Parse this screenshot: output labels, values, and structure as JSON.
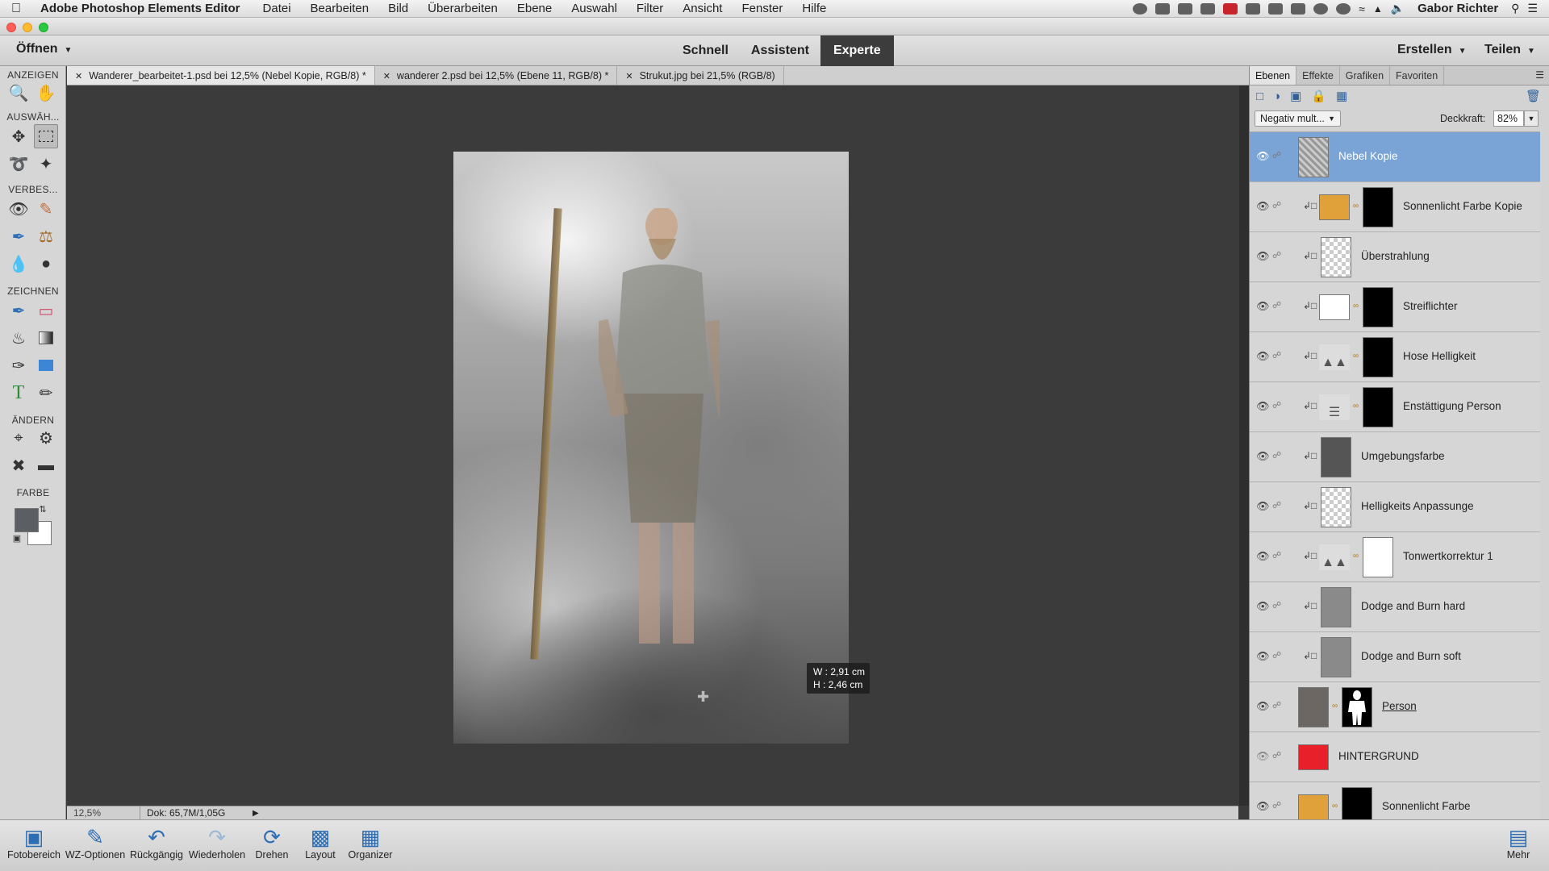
{
  "menubar": {
    "app_name": "Adobe Photoshop Elements Editor",
    "menus": [
      "Datei",
      "Bearbeiten",
      "Bild",
      "Überarbeiten",
      "Ebene",
      "Auswahl",
      "Filter",
      "Ansicht",
      "Fenster",
      "Hilfe"
    ],
    "user": "Gabor Richter"
  },
  "toolbar": {
    "open_label": "Öffnen",
    "modes": [
      "Schnell",
      "Assistent",
      "Experte"
    ],
    "active_mode": "Experte",
    "create_label": "Erstellen",
    "share_label": "Teilen"
  },
  "tools": {
    "sections": [
      "ANZEIGEN",
      "AUSWÄH...",
      "VERBES...",
      "ZEICHNEN",
      "ÄNDERN",
      "FARBE"
    ]
  },
  "doc_tabs": [
    {
      "label": "Wanderer_bearbeitet-1.psd bei 12,5% (Nebel Kopie, RGB/8) *",
      "active": true
    },
    {
      "label": "wanderer 2.psd bei 12,5% (Ebene 11, RGB/8) *",
      "active": false
    },
    {
      "label": "Strukut.jpg bei 21,5% (RGB/8)",
      "active": false
    }
  ],
  "canvas": {
    "measure_w": "W : 2,91 cm",
    "measure_h": "H : 2,46 cm"
  },
  "status": {
    "zoom": "12,5%",
    "doc_size": "Dok: 65,7M/1,05G"
  },
  "panel": {
    "tabs": [
      "Ebenen",
      "Effekte",
      "Grafiken",
      "Favoriten"
    ],
    "active_tab": "Ebenen",
    "blend_mode": "Negativ mult...",
    "opacity_label": "Deckkraft:",
    "opacity_value": "82%"
  },
  "layers": [
    {
      "name": "Nebel Kopie",
      "active": true
    },
    {
      "name": "Sonnenlicht Farbe Kopie"
    },
    {
      "name": "Überstrahlung"
    },
    {
      "name": "Streiflichter"
    },
    {
      "name": "Hose Helligkeit"
    },
    {
      "name": "Enstättigung Person"
    },
    {
      "name": "Umgebungsfarbe"
    },
    {
      "name": "Helligkeits Anpassunge"
    },
    {
      "name": "Tonwertkorrektur 1"
    },
    {
      "name": "Dodge and Burn hard"
    },
    {
      "name": "Dodge and Burn soft"
    },
    {
      "name": "Person"
    },
    {
      "name": "HINTERGRUND"
    },
    {
      "name": "Sonnenlicht Farbe"
    }
  ],
  "bottombar": {
    "items": [
      "Fotobereich",
      "WZ-Optionen",
      "Rückgängig",
      "Wiederholen",
      "Drehen",
      "Layout",
      "Organizer",
      "Mehr"
    ]
  },
  "colors": {
    "accent": "#7aa4d6",
    "foreground_color": "#5b5f63",
    "background_color": "#ffffff"
  }
}
